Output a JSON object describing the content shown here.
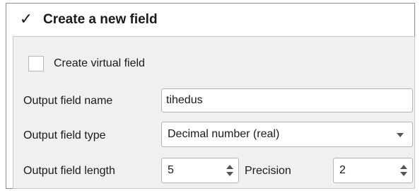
{
  "group": {
    "title": "Create a new field",
    "checked": true,
    "check_glyph": "✓"
  },
  "virtual_field": {
    "label": "Create virtual field",
    "checked": false
  },
  "output_name": {
    "label": "Output field name",
    "value": "tihedus"
  },
  "output_type": {
    "label": "Output field type",
    "selected": "Decimal number (real)"
  },
  "output_length": {
    "label": "Output field length",
    "value": "5"
  },
  "precision": {
    "label": "Precision",
    "value": "2"
  },
  "colors": {
    "panel_background": "#f0f0f0",
    "input_background": "#ffffff",
    "border": "#b4b4b4"
  }
}
